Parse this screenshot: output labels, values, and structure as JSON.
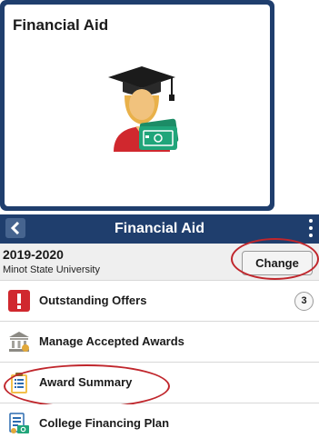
{
  "tile": {
    "title": "Financial Aid",
    "icon": "graduate-with-money-icon"
  },
  "header": {
    "title": "Financial Aid",
    "back_icon": "chevron-left-icon",
    "menu_icon": "kebab-menu-icon"
  },
  "term": {
    "year": "2019-2020",
    "school": "Minot State University",
    "change_label": "Change"
  },
  "menu": {
    "items": [
      {
        "label": "Outstanding Offers",
        "icon": "alert-icon",
        "badge": "3"
      },
      {
        "label": "Manage Accepted Awards",
        "icon": "bank-icon"
      },
      {
        "label": "Award Summary",
        "icon": "clipboard-list-icon"
      },
      {
        "label": "College Financing Plan",
        "icon": "financing-plan-icon"
      }
    ]
  },
  "colors": {
    "header_bg": "#1f3e6d",
    "highlight_ring": "#c0262c",
    "alert_red": "#d0282e",
    "money_green": "#20a57a"
  }
}
